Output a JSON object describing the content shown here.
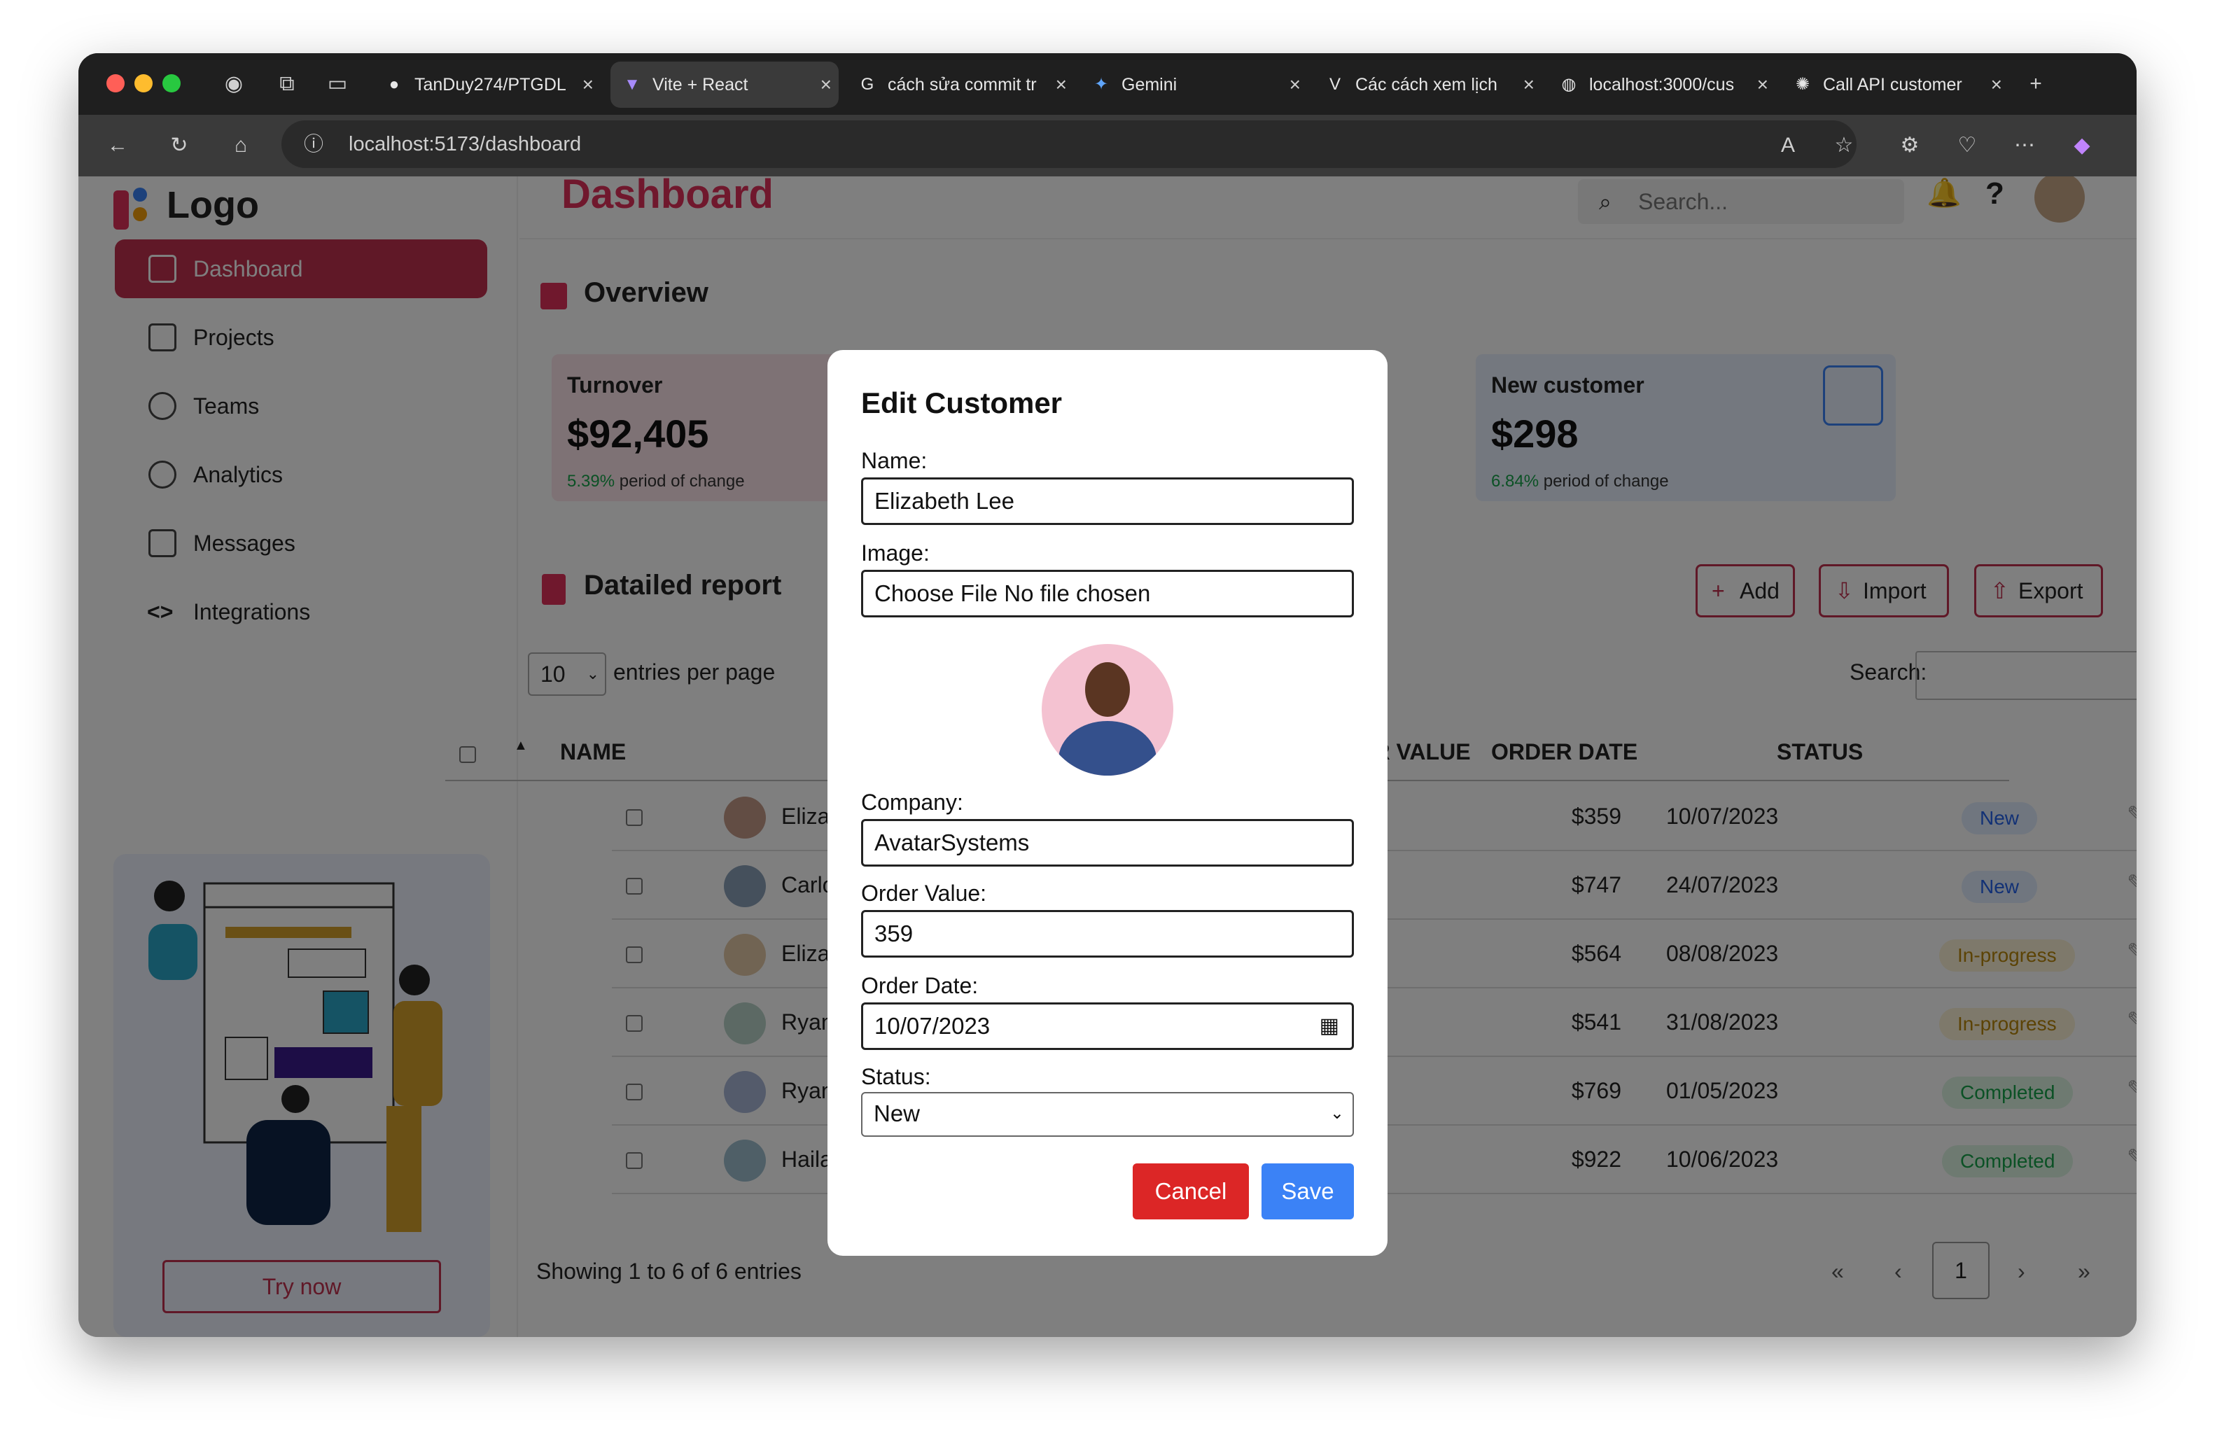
{
  "browser": {
    "tabs": [
      "TanDuy274/PTGDL",
      "Vite + React",
      "cách sửa commit tr",
      "Gemini",
      "Các cách xem lịch",
      "localhost:3000/cus",
      "Call API customer"
    ],
    "url": "localhost:5173/dashboard"
  },
  "sidebar": {
    "logo": "Logo",
    "items": [
      "Dashboard",
      "Projects",
      "Teams",
      "Analytics",
      "Messages",
      "Integrations"
    ],
    "try_now": "Try now"
  },
  "header": {
    "title": "Dashboard",
    "search_placeholder": "Search..."
  },
  "overview": {
    "title": "Overview",
    "cards": [
      {
        "label": "Turnover",
        "value": "$92,405",
        "pct": "5.39%",
        "note": "period of change"
      },
      {
        "label": "New customer",
        "value": "$298",
        "pct": "6.84%",
        "note": "period of change"
      }
    ]
  },
  "report": {
    "title": "Datailed report",
    "buttons": {
      "add": "Add",
      "import": "Import",
      "export": "Export"
    },
    "per_page": "10",
    "per_page_label": "entries per page",
    "search_label": "Search:",
    "columns": [
      "NAME",
      "ORDER VALUE",
      "ORDER DATE",
      "STATUS"
    ],
    "rows": [
      {
        "name": "Elizabeth Le",
        "value": "$359",
        "date": "10/07/2023",
        "status": "New"
      },
      {
        "name": "Carlos Garc",
        "value": "$747",
        "date": "24/07/2023",
        "status": "New"
      },
      {
        "name": "Elizabeth Ba",
        "value": "$564",
        "date": "08/08/2023",
        "status": "In-progress"
      },
      {
        "name": "Ryan Brown",
        "value": "$541",
        "date": "31/08/2023",
        "status": "In-progress"
      },
      {
        "name": "Ryan Young",
        "value": "$769",
        "date": "01/05/2023",
        "status": "Completed"
      },
      {
        "name": "Hailay Adam",
        "value": "$922",
        "date": "10/06/2023",
        "status": "Completed"
      }
    ],
    "showing": "Showing 1 to 6 of 6 entries",
    "page": "1",
    "pager": {
      "first": "«",
      "prev": "‹",
      "next": "›",
      "last": "»"
    }
  },
  "modal": {
    "title": "Edit Customer",
    "name_label": "Name:",
    "name_value": "Elizabeth Lee",
    "image_label": "Image:",
    "image_value": "Choose File No file chosen",
    "company_label": "Company:",
    "company_value": "AvatarSystems",
    "order_value_label": "Order Value:",
    "order_value": "359",
    "order_date_label": "Order Date:",
    "order_date": "10/07/2023",
    "status_label": "Status:",
    "status_value": "New",
    "cancel": "Cancel",
    "save": "Save"
  },
  "colors": {
    "accent": "#c0304f",
    "save": "#3b82f6",
    "cancel": "#dc2626"
  }
}
